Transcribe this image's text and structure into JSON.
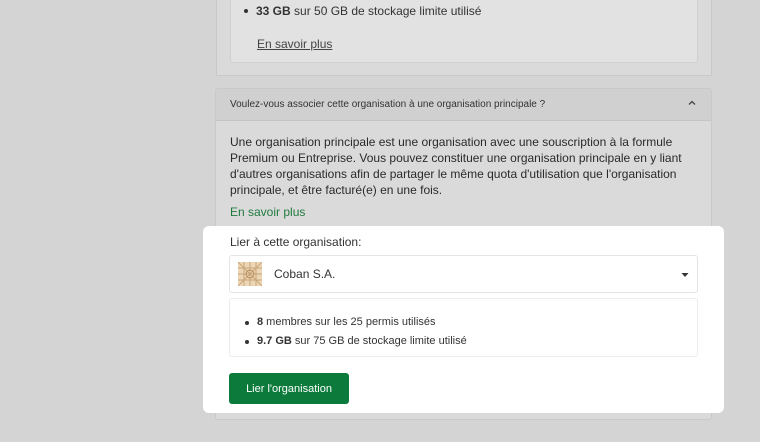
{
  "top_card": {
    "stat_value": "33 GB",
    "stat_text": " sur 50 GB de stockage limite utilisé",
    "more_link": "En savoir plus"
  },
  "accordion": {
    "question": "Voulez-vous associer cette organisation à une organisation principale ?",
    "body": "Une organisation principale est une organisation avec une souscription à la formule Premium ou Entreprise. Vous pouvez constituer une organisation principale en y liant d'autres organisations afin de partager le même quota d'utilisation que l'organisation principale, et être facturé(e) en une fois.",
    "more_link": "En savoir plus"
  },
  "link_panel": {
    "label": "Lier à cette organisation:",
    "selected_org": "Coban S.A.",
    "members_value": "8",
    "members_text": " membres sur les 25 permis utilisés",
    "storage_value": "9.7 GB",
    "storage_text": " sur 75 GB de stockage limite utilisé",
    "button_label": "Lier l'organisation"
  },
  "colors": {
    "accent_green": "#0b7a3b",
    "link_green": "#1f7a3e",
    "overlay": "#d4d4d4"
  },
  "icons": {
    "org_logo": "org-logo-icon",
    "caret": "caret-down-icon",
    "chevron": "chevron-up-icon"
  }
}
